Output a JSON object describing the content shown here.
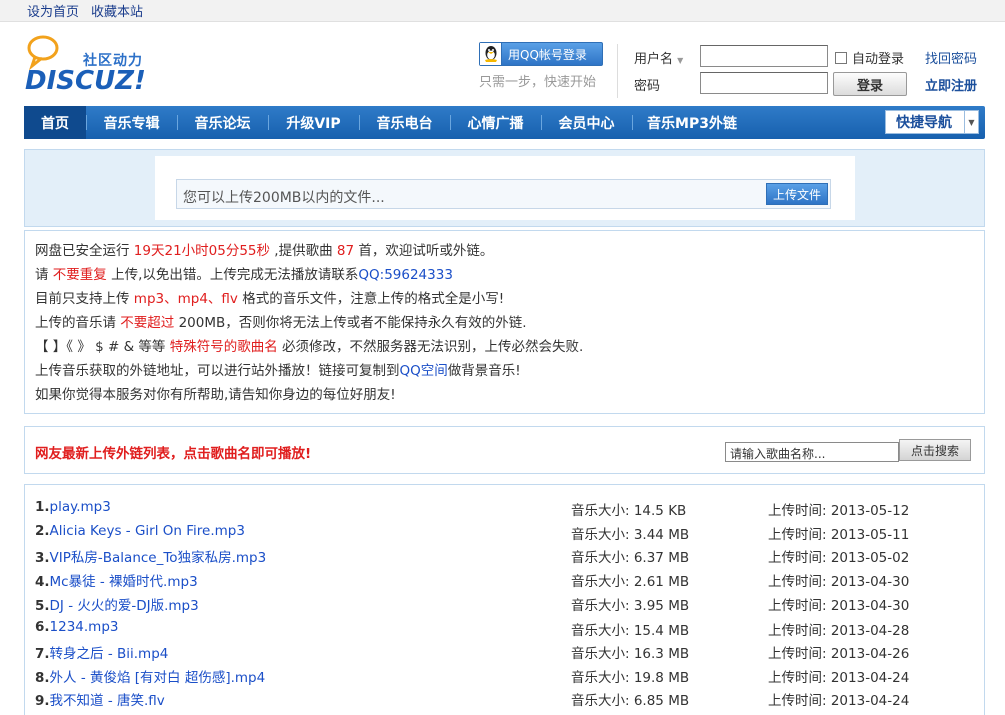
{
  "topbar": {
    "set_home": "设为首页",
    "bookmark": "收藏本站"
  },
  "logo": {
    "cn": "社区动力",
    "en": "DISCUZ!"
  },
  "qq": {
    "login_label": "用QQ帐号登录",
    "tip": "只需一步，快速开始"
  },
  "login": {
    "username_label": "用户名",
    "password_label": "密码",
    "auto_login": "自动登录",
    "login_button": "登录",
    "find_password": "找回密码",
    "register": "立即注册"
  },
  "nav": {
    "items": [
      "首页",
      "音乐专辑",
      "音乐论坛",
      "升级VIP",
      "音乐电台",
      "心情广播",
      "会员中心",
      "音乐MP3外链"
    ],
    "quick_nav": "快捷导航"
  },
  "upload": {
    "placeholder": "您可以上传200MB以内的文件...",
    "button": "上传文件"
  },
  "notice": {
    "l1_a": "网盘已安全运行 ",
    "l1_b": "19天21小时05分55秒",
    "l1_c": " ,提供歌曲 ",
    "l1_d": "87",
    "l1_e": " 首，欢迎试听或外链。",
    "l2_a": "请 ",
    "l2_b": "不要重复",
    "l2_c": " 上传,以免出错。上传完成无法播放请联系",
    "l2_d": "QQ:59624333",
    "l3_a": "目前只支持上传 ",
    "l3_b": "mp3、mp4、flv",
    "l3_c": " 格式的音乐文件，注意上传的格式全是小写!",
    "l4_a": "上传的音乐请 ",
    "l4_b": "不要超过",
    "l4_c": " 200MB，否则你将无法上传或者不能保持永久有效的外链.",
    "l5_a": "【 】《 》 $ # & 等等 ",
    "l5_b": "特殊符号的歌曲名",
    "l5_c": " 必须修改，不然服务器无法识别，上传必然会失败.",
    "l6_a": "上传音乐获取的外链地址，可以进行站外播放！链接可复制到",
    "l6_b": "QQ空间",
    "l6_c": "做背景音乐!",
    "l7": "如果你觉得本服务对你有所帮助,请告知你身边的每位好朋友!"
  },
  "list": {
    "title": "网友最新上传外链列表，点击歌曲名即可播放!",
    "search_placeholder": "请输入歌曲名称...",
    "search_button": "点击搜索",
    "songs": [
      {
        "num": "1.",
        "name": "play.mp3",
        "size": "音乐大小:  14.5 KB",
        "date": "上传时间:  2013-05-12"
      },
      {
        "num": "2.",
        "name": "Alicia Keys - Girl On Fire.mp3",
        "size": "音乐大小:  3.44 MB",
        "date": "上传时间:  2013-05-11"
      },
      {
        "num": "3.",
        "name": "VIP私房-Balance_To独家私房.mp3",
        "size": "音乐大小:  6.37 MB",
        "date": "上传时间:  2013-05-02"
      },
      {
        "num": "4.",
        "name": "Mc暴徒 - 裸婚时代.mp3",
        "size": "音乐大小:  2.61 MB",
        "date": "上传时间:  2013-04-30"
      },
      {
        "num": "5.",
        "name": "DJ - 火火的爱-DJ版.mp3",
        "size": "音乐大小:  3.95 MB",
        "date": "上传时间:  2013-04-30"
      },
      {
        "num": "6.",
        "name": "1234.mp3",
        "size": "音乐大小:  15.4 MB",
        "date": "上传时间:  2013-04-28"
      },
      {
        "num": "7.",
        "name": "转身之后 - Bii.mp4",
        "size": "音乐大小:  16.3 MB",
        "date": "上传时间:  2013-04-26"
      },
      {
        "num": "8.",
        "name": "外人 - 黄俊焰 [有对白 超伤感].mp4",
        "size": "音乐大小:  19.8 MB",
        "date": "上传时间:  2013-04-24"
      },
      {
        "num": "9.",
        "name": "我不知道 - 唐笑.flv",
        "size": "音乐大小:  6.85 MB",
        "date": "上传时间:  2013-04-24"
      }
    ]
  }
}
